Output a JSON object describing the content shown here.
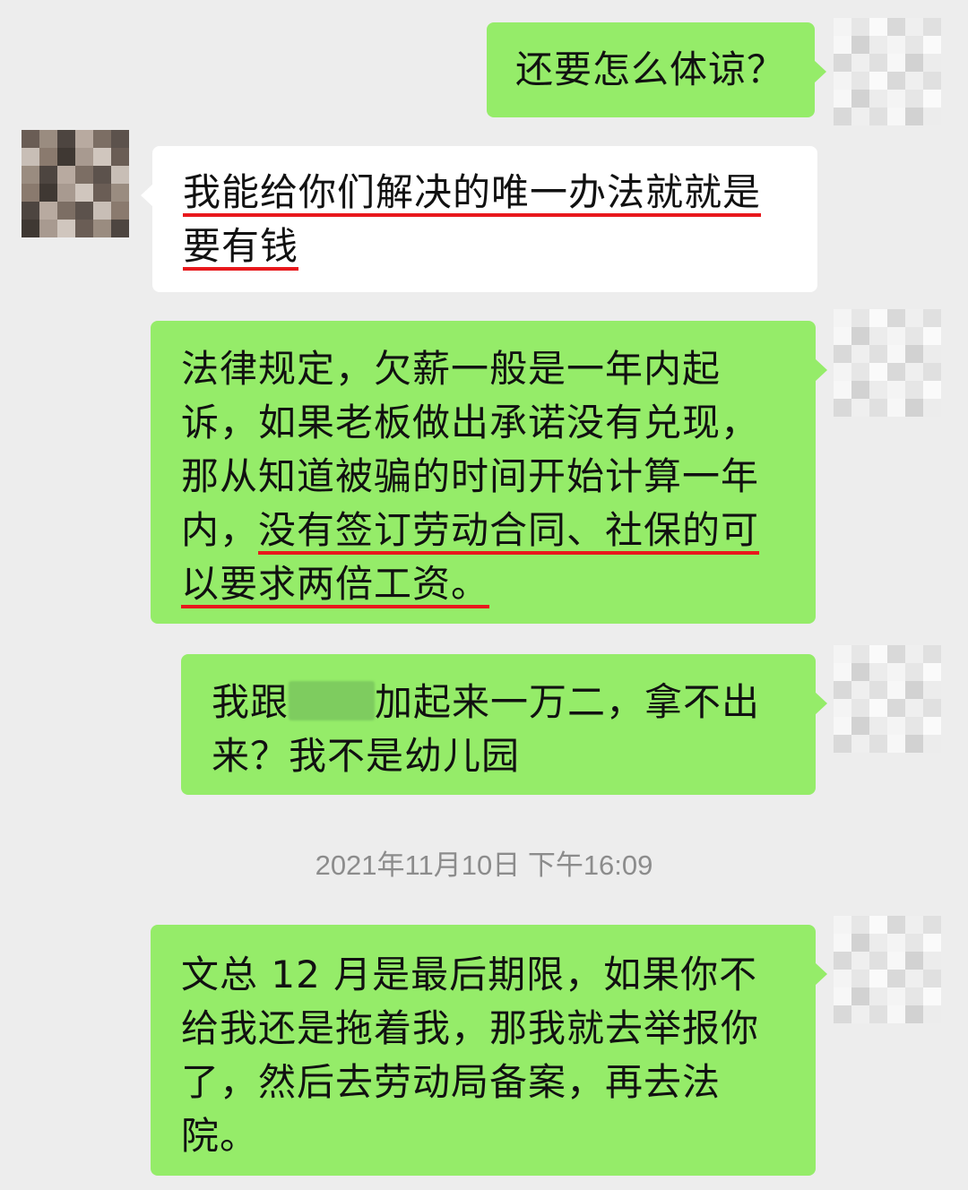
{
  "messages": [
    {
      "id": "m1",
      "sender": "me",
      "lines": [
        [
          {
            "text": "还要怎么体谅？",
            "underline": false
          }
        ]
      ]
    },
    {
      "id": "m2",
      "sender": "other",
      "lines": [
        [
          {
            "text": "我能给你们解决的唯一办法就就是",
            "underline": true
          }
        ],
        [
          {
            "text": "要有钱",
            "underline": true
          }
        ]
      ]
    },
    {
      "id": "m3",
      "sender": "me",
      "lines": [
        [
          {
            "text": "法律规定，欠薪一般是一年内起",
            "underline": false
          }
        ],
        [
          {
            "text": "诉，如果老板做出承诺没有兑现，",
            "underline": false
          }
        ],
        [
          {
            "text": "那从知道被骗的时间开始计算一年",
            "underline": false
          }
        ],
        [
          {
            "text": "内，",
            "underline": false
          },
          {
            "text": "没有签订劳动合同、社保的可",
            "underline": true
          }
        ],
        [
          {
            "text": "以要求两倍工资。",
            "underline": true
          }
        ]
      ]
    },
    {
      "id": "m4",
      "sender": "me",
      "line1_before_redaction": "我跟",
      "line1_after_redaction": "加起来一万二，拿不出",
      "line2": "来？我不是幼儿园"
    },
    {
      "id": "m5",
      "sender": "me",
      "lines": [
        [
          {
            "text": "文总 12 月是最后期限，如果你不",
            "underline": false
          }
        ],
        [
          {
            "text": "给我还是拖着我，那我就去举报你",
            "underline": false
          }
        ],
        [
          {
            "text": "了，然后去劳动局备案，再去法",
            "underline": false
          }
        ],
        [
          {
            "text": "院。",
            "underline": false
          }
        ]
      ]
    }
  ],
  "timestamp": "2021年11月10日 下午16:09",
  "colors": {
    "background": "#ededed",
    "my_bubble": "#95ec69",
    "their_bubble": "#ffffff",
    "underline": "#e8181c",
    "timestamp_text": "#8c8c8c"
  },
  "icons": {
    "my_avatar": "avatar-pixelated-light",
    "other_avatar": "avatar-pixelated-dark"
  }
}
